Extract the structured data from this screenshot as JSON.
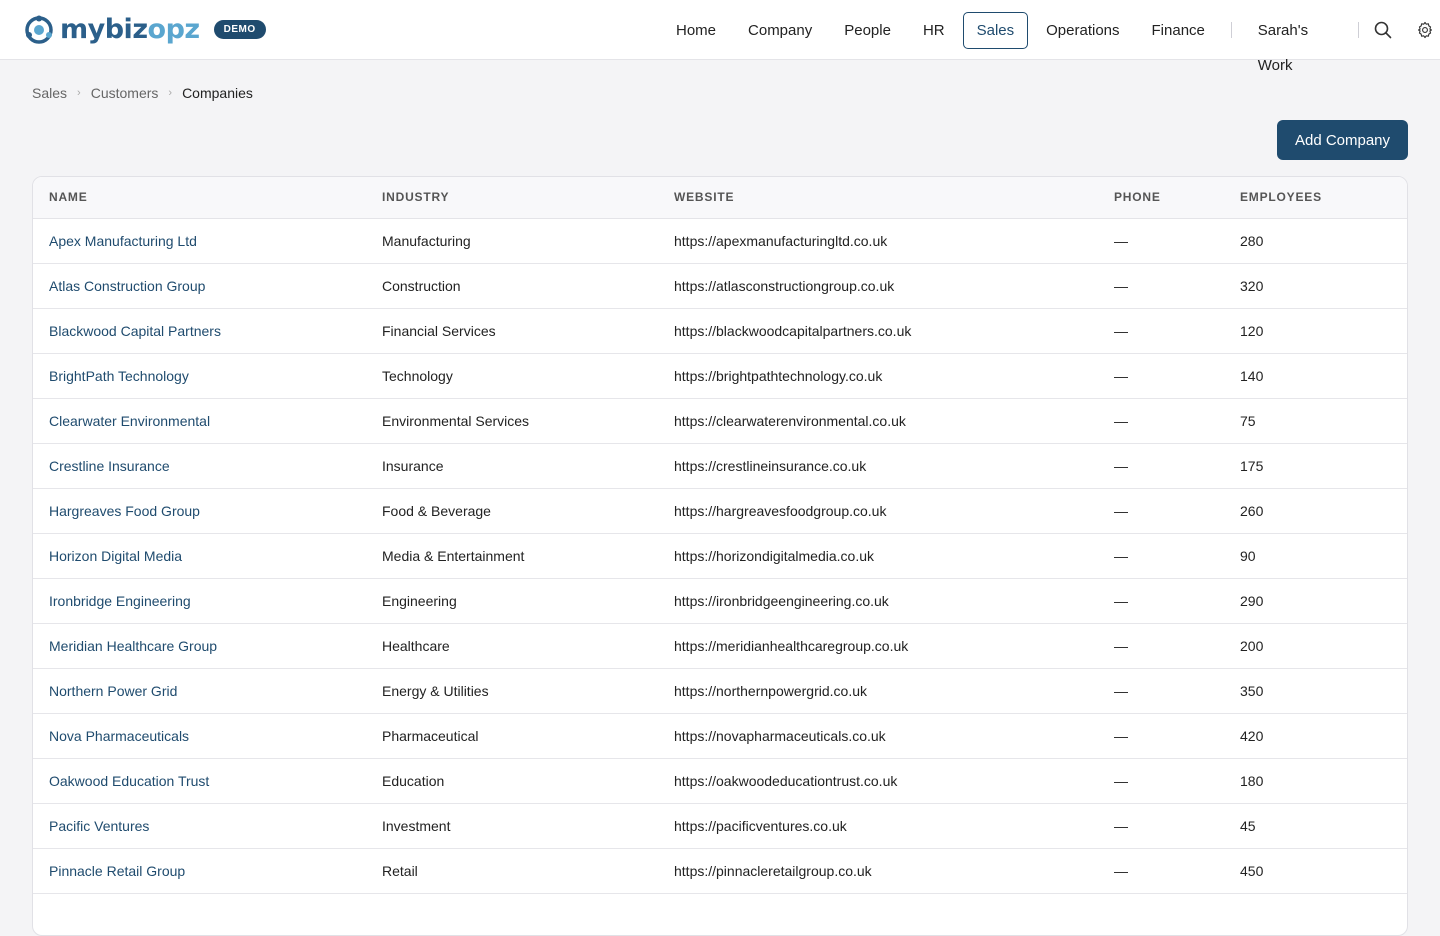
{
  "brand": {
    "name_part1": "mybiz",
    "name_part2": "opz",
    "badge": "DEMO"
  },
  "nav": {
    "items": [
      {
        "label": "Home"
      },
      {
        "label": "Company"
      },
      {
        "label": "People"
      },
      {
        "label": "HR"
      },
      {
        "label": "Sales"
      },
      {
        "label": "Operations"
      },
      {
        "label": "Finance"
      }
    ],
    "user_work": "Sarah's Work",
    "active": "Sales"
  },
  "breadcrumb": [
    "Sales",
    "Customers",
    "Companies"
  ],
  "actions": {
    "add_label": "Add Company"
  },
  "table": {
    "columns": [
      "NAME",
      "INDUSTRY",
      "WEBSITE",
      "PHONE",
      "EMPLOYEES"
    ],
    "rows": [
      {
        "name": "Apex Manufacturing Ltd",
        "industry": "Manufacturing",
        "website": "https://apexmanufacturingltd.co.uk",
        "phone": "—",
        "employees": "280"
      },
      {
        "name": "Atlas Construction Group",
        "industry": "Construction",
        "website": "https://atlasconstructiongroup.co.uk",
        "phone": "—",
        "employees": "320"
      },
      {
        "name": "Blackwood Capital Partners",
        "industry": "Financial Services",
        "website": "https://blackwoodcapitalpartners.co.uk",
        "phone": "—",
        "employees": "120"
      },
      {
        "name": "BrightPath Technology",
        "industry": "Technology",
        "website": "https://brightpathtechnology.co.uk",
        "phone": "—",
        "employees": "140"
      },
      {
        "name": "Clearwater Environmental",
        "industry": "Environmental Services",
        "website": "https://clearwaterenvironmental.co.uk",
        "phone": "—",
        "employees": "75"
      },
      {
        "name": "Crestline Insurance",
        "industry": "Insurance",
        "website": "https://crestlineinsurance.co.uk",
        "phone": "—",
        "employees": "175"
      },
      {
        "name": "Hargreaves Food Group",
        "industry": "Food & Beverage",
        "website": "https://hargreavesfoodgroup.co.uk",
        "phone": "—",
        "employees": "260"
      },
      {
        "name": "Horizon Digital Media",
        "industry": "Media & Entertainment",
        "website": "https://horizondigitalmedia.co.uk",
        "phone": "—",
        "employees": "90"
      },
      {
        "name": "Ironbridge Engineering",
        "industry": "Engineering",
        "website": "https://ironbridgeengineering.co.uk",
        "phone": "—",
        "employees": "290"
      },
      {
        "name": "Meridian Healthcare Group",
        "industry": "Healthcare",
        "website": "https://meridianhealthcaregroup.co.uk",
        "phone": "—",
        "employees": "200"
      },
      {
        "name": "Northern Power Grid",
        "industry": "Energy & Utilities",
        "website": "https://northernpowergrid.co.uk",
        "phone": "—",
        "employees": "350"
      },
      {
        "name": "Nova Pharmaceuticals",
        "industry": "Pharmaceutical",
        "website": "https://novapharmaceuticals.co.uk",
        "phone": "—",
        "employees": "420"
      },
      {
        "name": "Oakwood Education Trust",
        "industry": "Education",
        "website": "https://oakwoodeducationtrust.co.uk",
        "phone": "—",
        "employees": "180"
      },
      {
        "name": "Pacific Ventures",
        "industry": "Investment",
        "website": "https://pacificventures.co.uk",
        "phone": "—",
        "employees": "45"
      },
      {
        "name": "Pinnacle Retail Group",
        "industry": "Retail",
        "website": "https://pinnacleretailgroup.co.uk",
        "phone": "—",
        "employees": "450"
      }
    ]
  },
  "colors": {
    "primary": "#1f4b6e",
    "brand_light": "#5aa6cf",
    "background": "#f4f4f6"
  },
  "icons": {
    "logo": "logo-icon",
    "search": "search-icon",
    "settings": "gear-icon",
    "breadcrumb_sep": "chevron-right-icon"
  }
}
